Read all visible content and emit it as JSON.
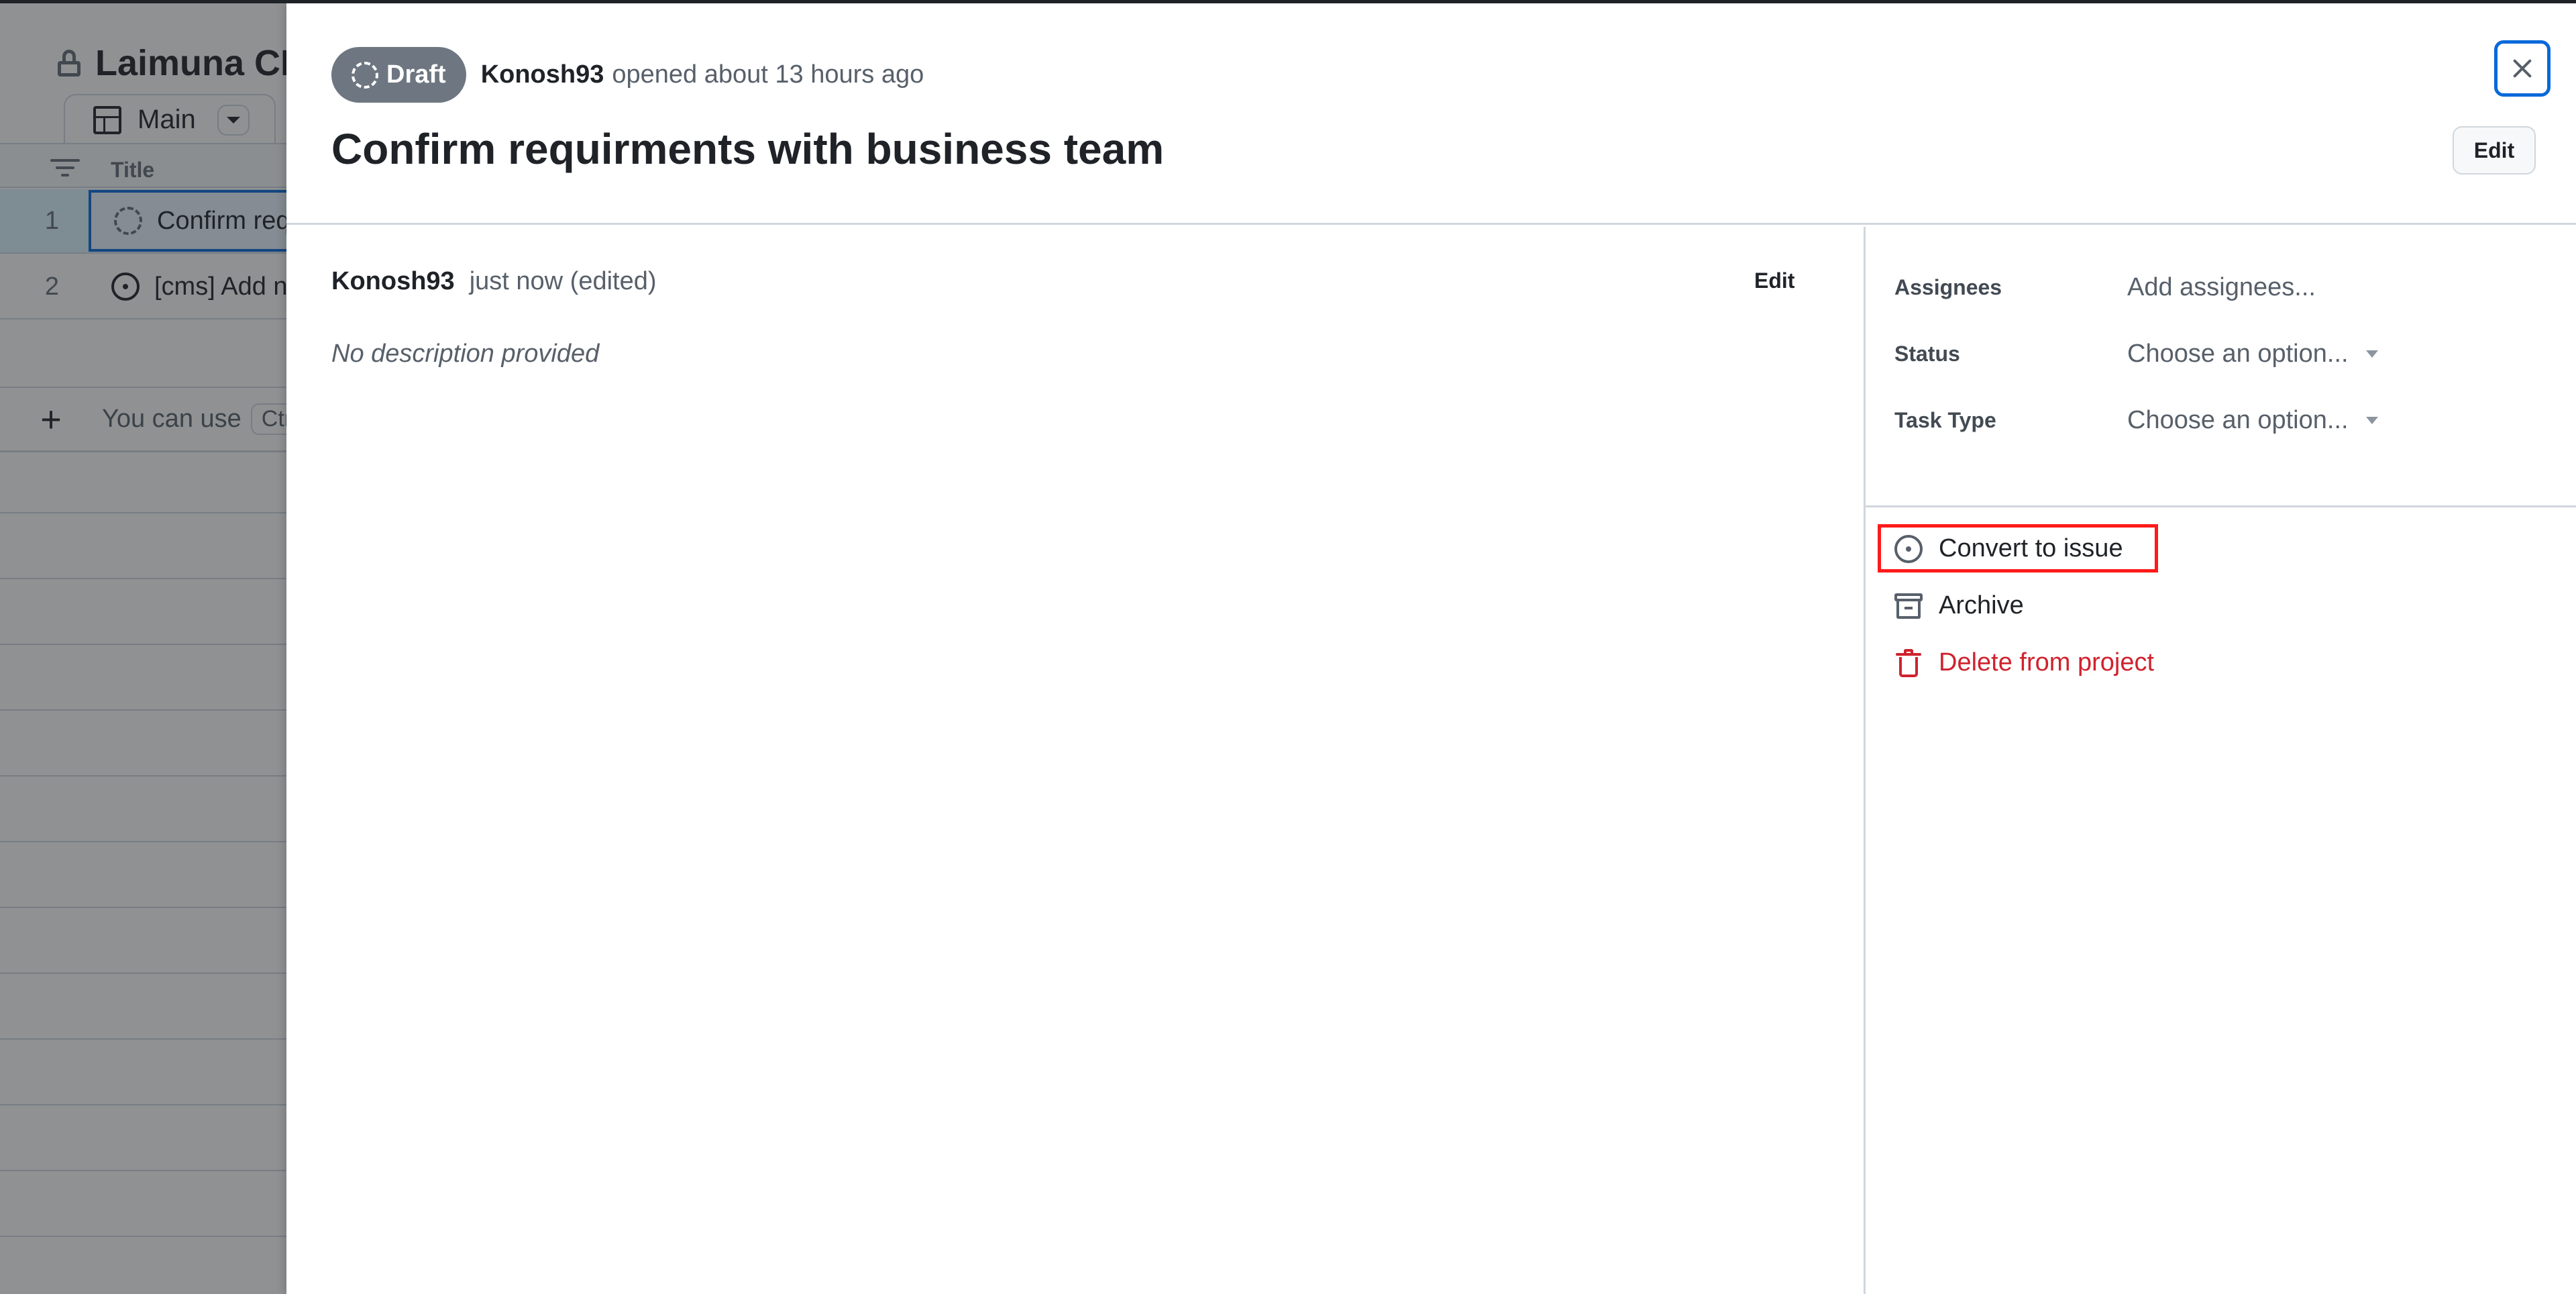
{
  "board": {
    "title": "Laimuna CMS",
    "view_tab": {
      "label": "Main"
    },
    "columns": {
      "title": "Title"
    },
    "rows": [
      {
        "number": "1",
        "status_icon": "draft-icon",
        "title": "Confirm requirments with business team"
      },
      {
        "number": "2",
        "status_icon": "open-issue-icon",
        "title": "[cms] Add new…"
      }
    ],
    "add_row": {
      "hint_text": "You can use",
      "kbd": "Ctrl"
    }
  },
  "panel": {
    "badge": {
      "label": "Draft",
      "color": "#6e7781"
    },
    "author": "Konosh93",
    "opened_text": "opened about 13 hours ago",
    "title": "Confirm requirments with business team",
    "edit_title_label": "Edit",
    "close_label": "Close",
    "comment": {
      "author": "Konosh93",
      "time": "just now (edited)",
      "edit_label": "Edit",
      "body": "No description provided"
    },
    "fields": [
      {
        "label": "Assignees",
        "value": "Add assignees...",
        "has_caret": false
      },
      {
        "label": "Status",
        "value": "Choose an option...",
        "has_caret": true
      },
      {
        "label": "Task Type",
        "value": "Choose an option...",
        "has_caret": true
      }
    ],
    "actions": [
      {
        "label": "Convert to issue",
        "icon": "issue-opened-icon",
        "highlighted": true
      },
      {
        "label": "Archive",
        "icon": "archive-icon"
      },
      {
        "label": "Delete from project",
        "icon": "trash-icon",
        "color": "#cf222e"
      }
    ]
  },
  "colors": {
    "accent": "#0969da",
    "danger": "#cf222e",
    "highlight": "#ff1a1a"
  }
}
